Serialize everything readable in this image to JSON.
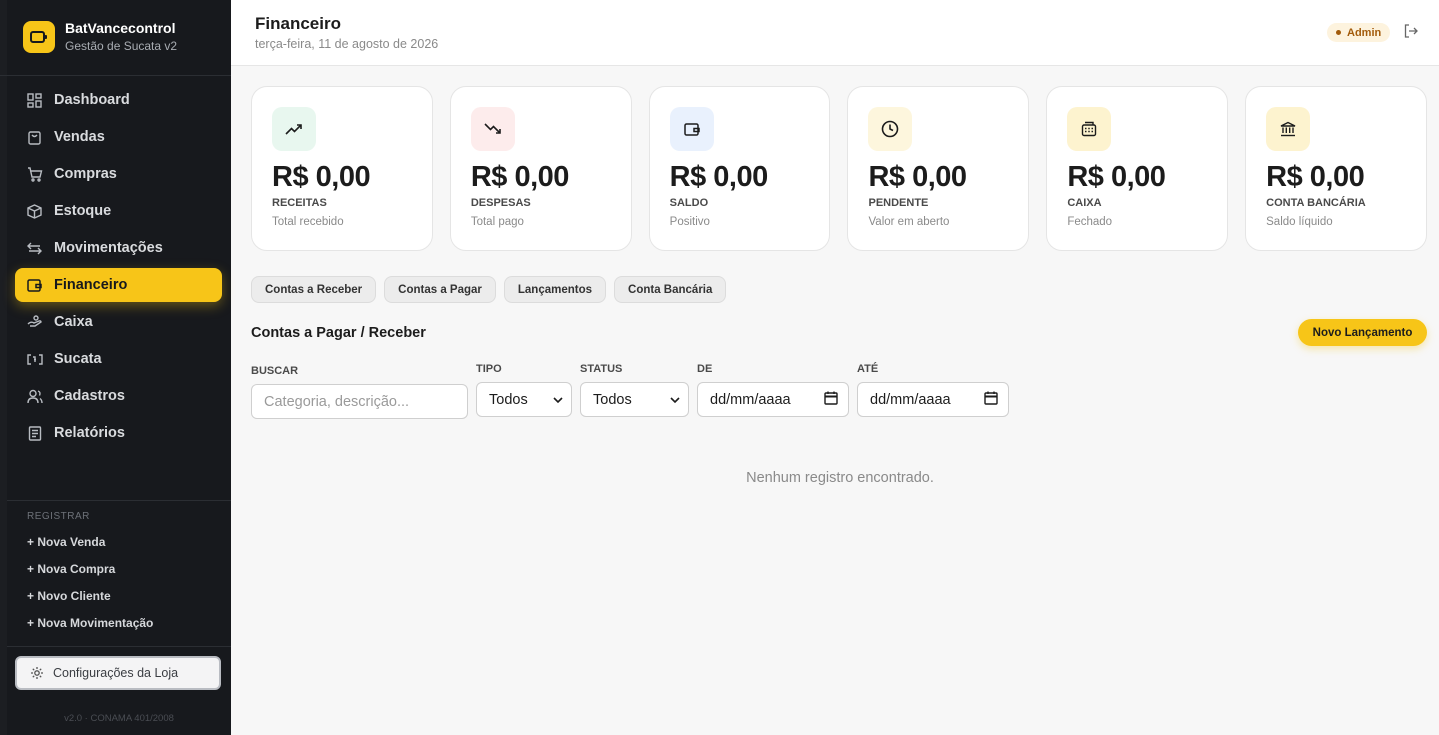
{
  "brand": {
    "title": "BatVancecontrol",
    "subtitle": "Gestão de Sucata v2"
  },
  "nav": {
    "items": [
      {
        "label": "Dashboard",
        "icon": "dashboard-icon"
      },
      {
        "label": "Vendas",
        "icon": "bag-icon"
      },
      {
        "label": "Compras",
        "icon": "cart-icon"
      },
      {
        "label": "Estoque",
        "icon": "box-icon"
      },
      {
        "label": "Movimentações",
        "icon": "arrows-icon"
      },
      {
        "label": "Financeiro",
        "icon": "wallet-icon",
        "active": true
      },
      {
        "label": "Caixa",
        "icon": "cash-icon"
      },
      {
        "label": "Sucata",
        "icon": "recycle-icon"
      },
      {
        "label": "Cadastros",
        "icon": "users-icon"
      },
      {
        "label": "Relatórios",
        "icon": "report-icon"
      }
    ]
  },
  "register": {
    "title": "REGISTRAR",
    "items": [
      "+ Nova Venda",
      "+ Nova Compra",
      "+ Novo Cliente",
      "+ Nova Movimentação"
    ]
  },
  "settings": {
    "label": "Configurações da Loja"
  },
  "version": "v2.0 · CONAMA 401/2008",
  "header": {
    "title": "Financeiro",
    "date": "terça-feira, 11 de agosto de 2026",
    "badge": "Admin"
  },
  "cards": [
    {
      "value": "R$ 0,00",
      "label": "RECEITAS",
      "sub": "Total recebido",
      "icon": "trend-up-icon",
      "bg": "#e8f7ef"
    },
    {
      "value": "R$ 0,00",
      "label": "DESPESAS",
      "sub": "Total pago",
      "icon": "trend-down-icon",
      "bg": "#fdecec"
    },
    {
      "value": "R$ 0,00",
      "label": "SALDO",
      "sub": "Positivo",
      "icon": "wallet-icon",
      "bg": "#e9f1fd"
    },
    {
      "value": "R$ 0,00",
      "label": "PENDENTE",
      "sub": "Valor em aberto",
      "icon": "clock-icon",
      "bg": "#fdf6dd"
    },
    {
      "value": "R$ 0,00",
      "label": "CAIXA",
      "sub": "Fechado",
      "icon": "register-icon",
      "bg": "#fdf3cf"
    },
    {
      "value": "R$ 0,00",
      "label": "CONTA BANCÁRIA",
      "sub": "Saldo líquido",
      "icon": "bank-icon",
      "bg": "#fdf3cf"
    }
  ],
  "tabs": [
    "Contas a Receber",
    "Contas a Pagar",
    "Lançamentos",
    "Conta Bancária"
  ],
  "section": {
    "title": "Contas a Pagar / Receber",
    "new_button": "Novo Lançamento"
  },
  "filters": {
    "search_label": "BUSCAR",
    "search_placeholder": "Categoria, descrição...",
    "tipo_label": "TIPO",
    "tipo_value": "Todos",
    "status_label": "STATUS",
    "status_value": "Todos",
    "de_label": "DE",
    "de_value": "dd/mm/aaaa",
    "ate_label": "ATÉ",
    "ate_value": "dd/mm/aaaa"
  },
  "empty_message": "Nenhum registro encontrado."
}
